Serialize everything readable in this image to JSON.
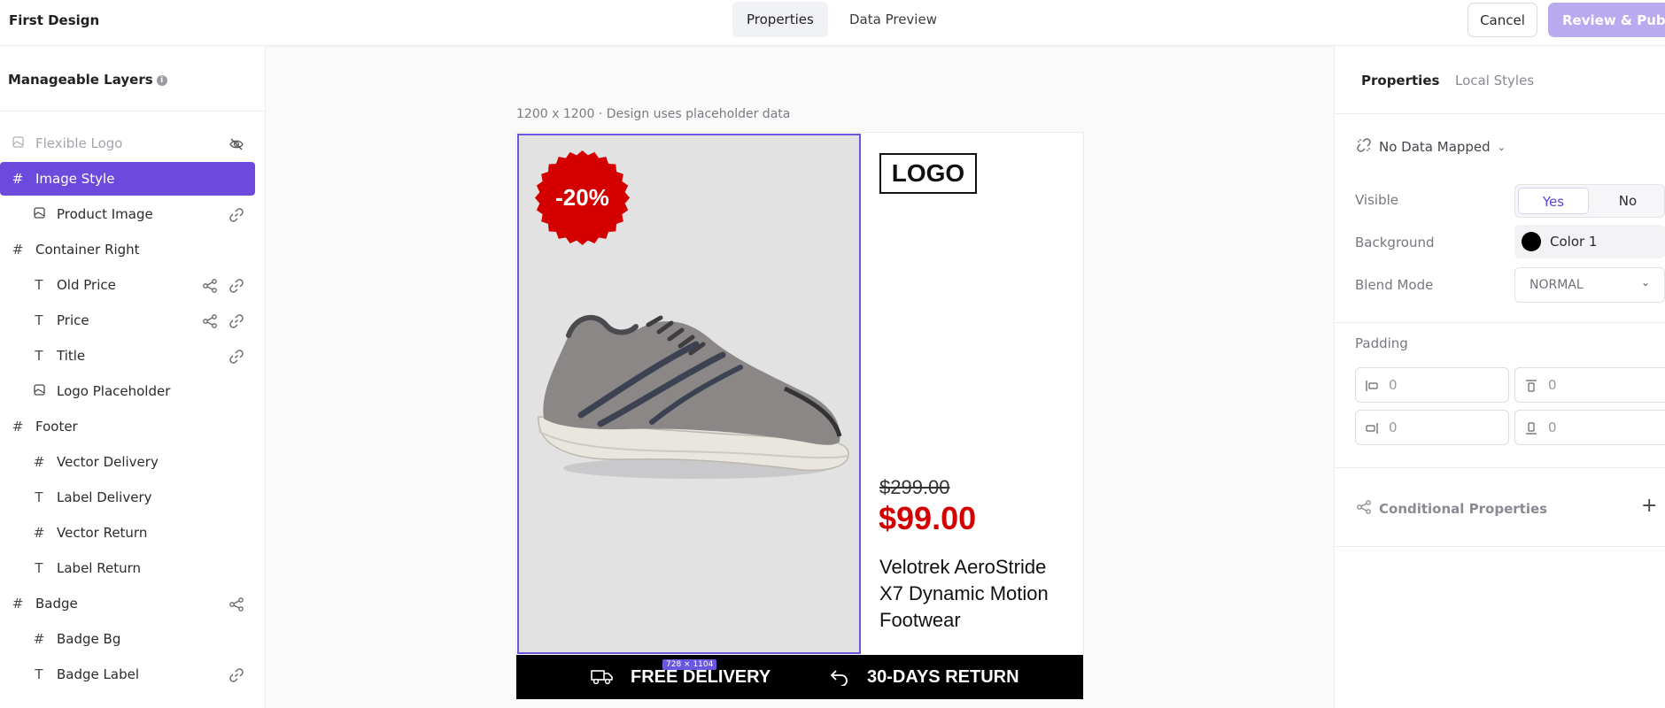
{
  "header": {
    "title": "First Design",
    "tabs": [
      {
        "label": "Properties"
      },
      {
        "label": "Data Preview"
      }
    ],
    "cancel_label": "Cancel",
    "publish_label": "Review & Publish"
  },
  "layers_panel": {
    "title": "Manageable Layers",
    "items": [
      {
        "label": "Flexible Logo",
        "icon": "image-icon"
      },
      {
        "label": "Image Style",
        "icon": "hash-icon"
      },
      {
        "label": "Product Image",
        "icon": "image-icon"
      },
      {
        "label": "Container Right",
        "icon": "hash-icon"
      },
      {
        "label": "Old Price",
        "icon": "text-icon"
      },
      {
        "label": "Price",
        "icon": "text-icon"
      },
      {
        "label": "Title",
        "icon": "text-icon"
      },
      {
        "label": "Logo Placeholder",
        "icon": "image-icon"
      },
      {
        "label": "Footer",
        "icon": "hash-icon"
      },
      {
        "label": "Vector Delivery",
        "icon": "hash-icon"
      },
      {
        "label": "Label Delivery",
        "icon": "text-icon"
      },
      {
        "label": "Vector Return",
        "icon": "hash-icon"
      },
      {
        "label": "Label Return",
        "icon": "text-icon"
      },
      {
        "label": "Badge",
        "icon": "hash-icon"
      },
      {
        "label": "Badge Bg",
        "icon": "hash-icon"
      },
      {
        "label": "Badge Label",
        "icon": "text-icon"
      }
    ]
  },
  "canvas": {
    "info": "1200 x 1200 · Design uses placeholder data",
    "badge_text": "-20%",
    "logo_text": "LOGO",
    "old_price": "$299.00",
    "price": "$99.00",
    "product_title": "Velotrek AeroStride X7 Dynamic Motion Footwear",
    "delivery_label": "FREE DELIVERY",
    "return_label": "30-DAYS RETURN",
    "selection_size": "728 × 1104",
    "colors": {
      "selection": "#6a57e0",
      "badge": "#d40000",
      "price": "#d40000",
      "footer": "#000000"
    }
  },
  "properties_panel": {
    "tabs": [
      {
        "label": "Properties"
      },
      {
        "label": "Local Styles"
      }
    ],
    "data_mapping": "No Data Mapped",
    "visible_label": "Visible",
    "visible_yes": "Yes",
    "visible_no": "No",
    "background_label": "Background",
    "background_value": "Color 1",
    "blend_label": "Blend Mode",
    "blend_value": "NORMAL",
    "padding_label": "Padding",
    "padding": {
      "left": "0",
      "top": "0",
      "right": "0",
      "bottom": "0"
    },
    "conditional_label": "Conditional Properties"
  }
}
